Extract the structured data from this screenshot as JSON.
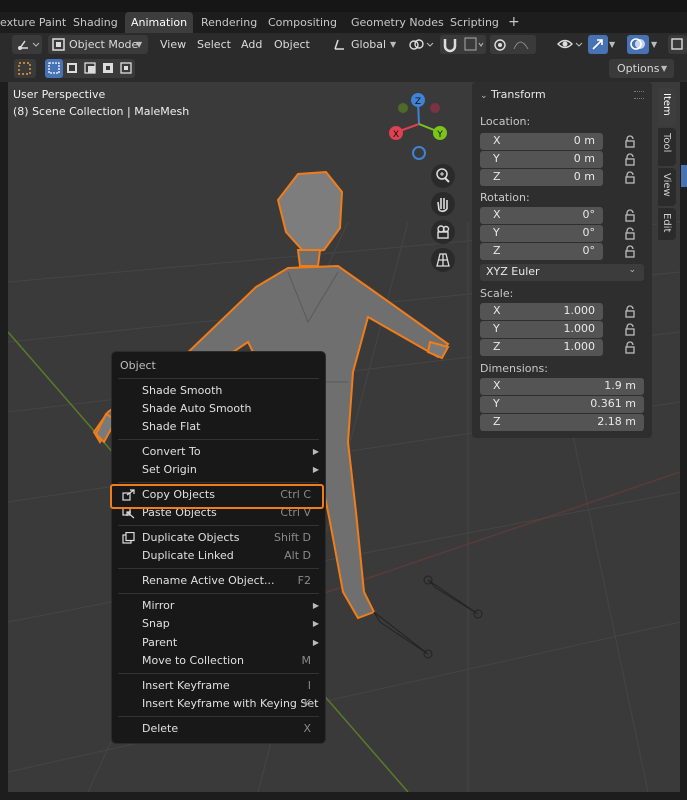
{
  "workspace_tabs": [
    "exture Paint",
    "Shading",
    "Animation",
    "Rendering",
    "Compositing",
    "Geometry Nodes",
    "Scripting",
    "+"
  ],
  "active_tab": "Animation",
  "header": {
    "mode": "Object Mode",
    "menus": [
      "View",
      "Select",
      "Add",
      "Object"
    ],
    "orientation": "Global",
    "options_label": "Options"
  },
  "viewport": {
    "perspective": "User Perspective",
    "collection": "(8) Scene Collection | MaleMesh",
    "gizmo_axes": [
      "Z",
      "X",
      "Y"
    ]
  },
  "transform_panel": {
    "title": "Transform",
    "location_label": "Location:",
    "location": [
      {
        "axis": "X",
        "value": "0 m"
      },
      {
        "axis": "Y",
        "value": "0 m"
      },
      {
        "axis": "Z",
        "value": "0 m"
      }
    ],
    "rotation_label": "Rotation:",
    "rotation": [
      {
        "axis": "X",
        "value": "0°"
      },
      {
        "axis": "Y",
        "value": "0°"
      },
      {
        "axis": "Z",
        "value": "0°"
      }
    ],
    "rotation_mode": "XYZ Euler",
    "scale_label": "Scale:",
    "scale": [
      {
        "axis": "X",
        "value": "1.000"
      },
      {
        "axis": "Y",
        "value": "1.000"
      },
      {
        "axis": "Z",
        "value": "1.000"
      }
    ],
    "dimensions_label": "Dimensions:",
    "dimensions": [
      {
        "axis": "X",
        "value": "1.9 m"
      },
      {
        "axis": "Y",
        "value": "0.361 m"
      },
      {
        "axis": "Z",
        "value": "2.18 m"
      }
    ]
  },
  "side_tabs": [
    "Item",
    "Tool",
    "View",
    "Edit"
  ],
  "context_menu": {
    "title": "Object",
    "items": [
      {
        "label": "Shade Smooth",
        "shortcut": ""
      },
      {
        "label": "Shade Auto Smooth",
        "shortcut": ""
      },
      {
        "label": "Shade Flat",
        "shortcut": ""
      },
      {
        "label": "Convert To",
        "shortcut": "",
        "submenu": true
      },
      {
        "label": "Set Origin",
        "shortcut": "",
        "submenu": true
      },
      {
        "label": "Copy Objects",
        "shortcut": "Ctrl C",
        "highlighted": true
      },
      {
        "label": "Paste Objects",
        "shortcut": "Ctrl V"
      },
      {
        "label": "Duplicate Objects",
        "shortcut": "Shift D"
      },
      {
        "label": "Duplicate Linked",
        "shortcut": "Alt D"
      },
      {
        "label": "Rename Active Object...",
        "shortcut": "F2"
      },
      {
        "label": "Mirror",
        "shortcut": "",
        "submenu": true
      },
      {
        "label": "Snap",
        "shortcut": "",
        "submenu": true
      },
      {
        "label": "Parent",
        "shortcut": "",
        "submenu": true
      },
      {
        "label": "Move to Collection",
        "shortcut": "M"
      },
      {
        "label": "Insert Keyframe",
        "shortcut": "I"
      },
      {
        "label": "Insert Keyframe with Keying Set",
        "shortcut": "K"
      },
      {
        "label": "Delete",
        "shortcut": "X"
      }
    ]
  },
  "colors": {
    "selection_outline": "#f07d19",
    "axis_x": "#e0404f",
    "axis_y": "#7bc41b",
    "axis_z": "#3f83d6",
    "active_blue": "#4772b3"
  }
}
